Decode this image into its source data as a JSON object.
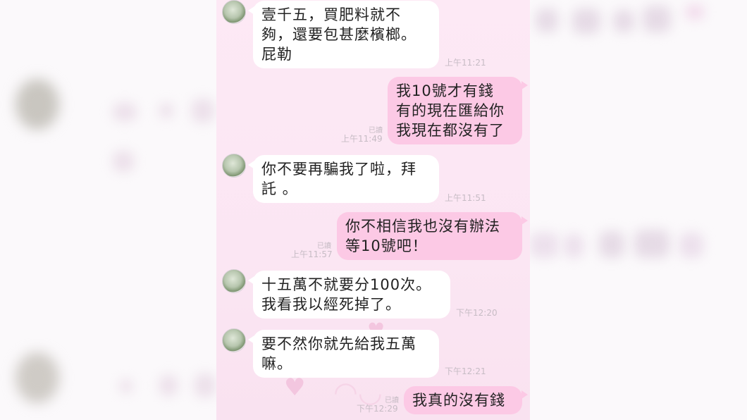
{
  "messages": [
    {
      "side": "in",
      "lines": [
        "壹千五，買肥料就不",
        "夠，還要包甚麼檳榔。",
        "屁勒"
      ],
      "time": "上午11:21"
    },
    {
      "side": "out",
      "lines": [
        "我10號才有錢",
        "有的現在匯給你",
        "我現在都沒有了"
      ],
      "time": "上午11:49",
      "read": "已讀"
    },
    {
      "side": "in",
      "lines": [
        "你不要再騙我了啦，拜",
        "託 。"
      ],
      "time": "上午11:51"
    },
    {
      "side": "out",
      "lines": [
        "你不相信我也沒有辦法",
        "等10號吧！"
      ],
      "time": "上午11:57",
      "read": "已讀"
    },
    {
      "side": "in",
      "lines": [
        "十五萬不就要分100次。",
        "我看我以經死掉了。"
      ],
      "time": "下午12:20"
    },
    {
      "side": "in",
      "lines": [
        "要不然你就先給我五萬",
        "嘛。"
      ],
      "time": "下午12:21"
    },
    {
      "side": "out",
      "lines": [
        "我真的沒有錢"
      ],
      "time": "下午12:29",
      "read": "已讀"
    }
  ],
  "colors": {
    "incoming_bubble": "#ffffff",
    "outgoing_bubble": "#fcc9e5",
    "background": "#fde9f5"
  },
  "icons": {
    "avatar": "bonsai-avatar"
  }
}
